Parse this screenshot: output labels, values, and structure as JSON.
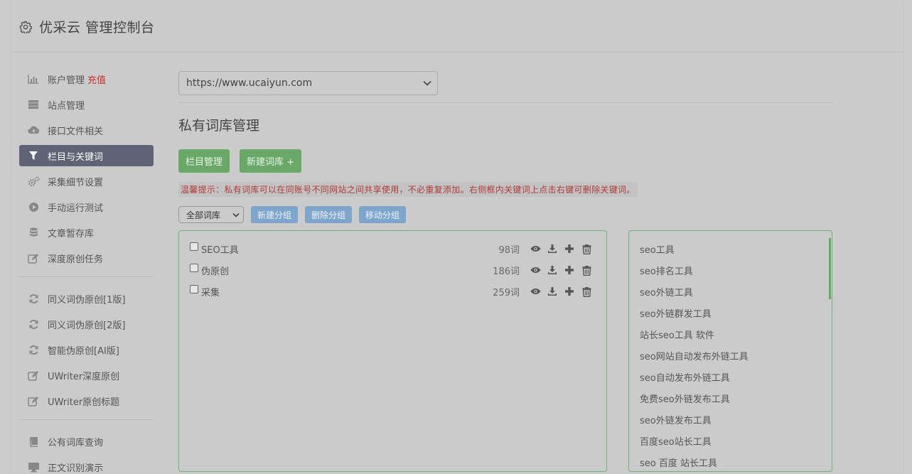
{
  "header": {
    "title": "优采云 管理控制台",
    "icon": "gear-icon"
  },
  "sidebar": {
    "group1": [
      {
        "label": "账户管理",
        "badge": "充值",
        "icon": "bar-chart-icon"
      },
      {
        "label": "站点管理",
        "icon": "server-icon"
      },
      {
        "label": "接口文件相关",
        "icon": "cloud-upload-icon"
      },
      {
        "label": "栏目与关键词",
        "icon": "filter-icon",
        "active": true
      },
      {
        "label": "采集细节设置",
        "icon": "gears-icon"
      },
      {
        "label": "手动运行测试",
        "icon": "play-circle-icon"
      },
      {
        "label": "文章暂存库",
        "icon": "database-icon"
      },
      {
        "label": "深度原创任务",
        "icon": "edit-icon"
      }
    ],
    "group2": [
      {
        "label": "同义词伪原创[1版]",
        "icon": "refresh-icon"
      },
      {
        "label": "同义词伪原创[2版]",
        "icon": "refresh-icon"
      },
      {
        "label": "智能伪原创[AI版]",
        "icon": "refresh-icon"
      },
      {
        "label": "UWriter深度原创",
        "icon": "edit-icon"
      },
      {
        "label": "UWriter原创标题",
        "icon": "edit-icon"
      }
    ],
    "group3": [
      {
        "label": "公有词库查询",
        "icon": "book-icon"
      },
      {
        "label": "正文识别演示",
        "icon": "monitor-icon"
      }
    ]
  },
  "main": {
    "site_select": "https://www.ucaiyun.com",
    "section_title": "私有词库管理",
    "btn_columns": "栏目管理",
    "btn_new_lib": "新建词库 +",
    "tip": "温馨提示：私有词库可以在同账号不同网站之间共享使用，不必重复添加。右侧框内关键词上点击右键可删除关键词。",
    "group_select": "全部词库",
    "btn_new_group": "新建分组",
    "btn_delete_group": "删除分组",
    "btn_move_group": "移动分组",
    "libraries": [
      {
        "name": "SEO工具",
        "count": "98词"
      },
      {
        "name": "伪原创",
        "count": "186词"
      },
      {
        "name": "采集",
        "count": "259词"
      }
    ],
    "keywords": [
      "seo工具",
      "seo排名工具",
      "seo外链工具",
      "seo外链群发工具",
      "站长seo工具 软件",
      "seo网站自动发布外链工具",
      "seo自动发布外链工具",
      "免费seo外链发布工具",
      "seo外链发布工具",
      "百度seo站长工具",
      "seo 百度 站长工具"
    ]
  },
  "colors": {
    "active_nav": "#5e6475",
    "green_button": "#6aa86a",
    "blue_button": "#7ea5cc",
    "tip_text": "#b03a3a",
    "badge": "#c9302c"
  }
}
